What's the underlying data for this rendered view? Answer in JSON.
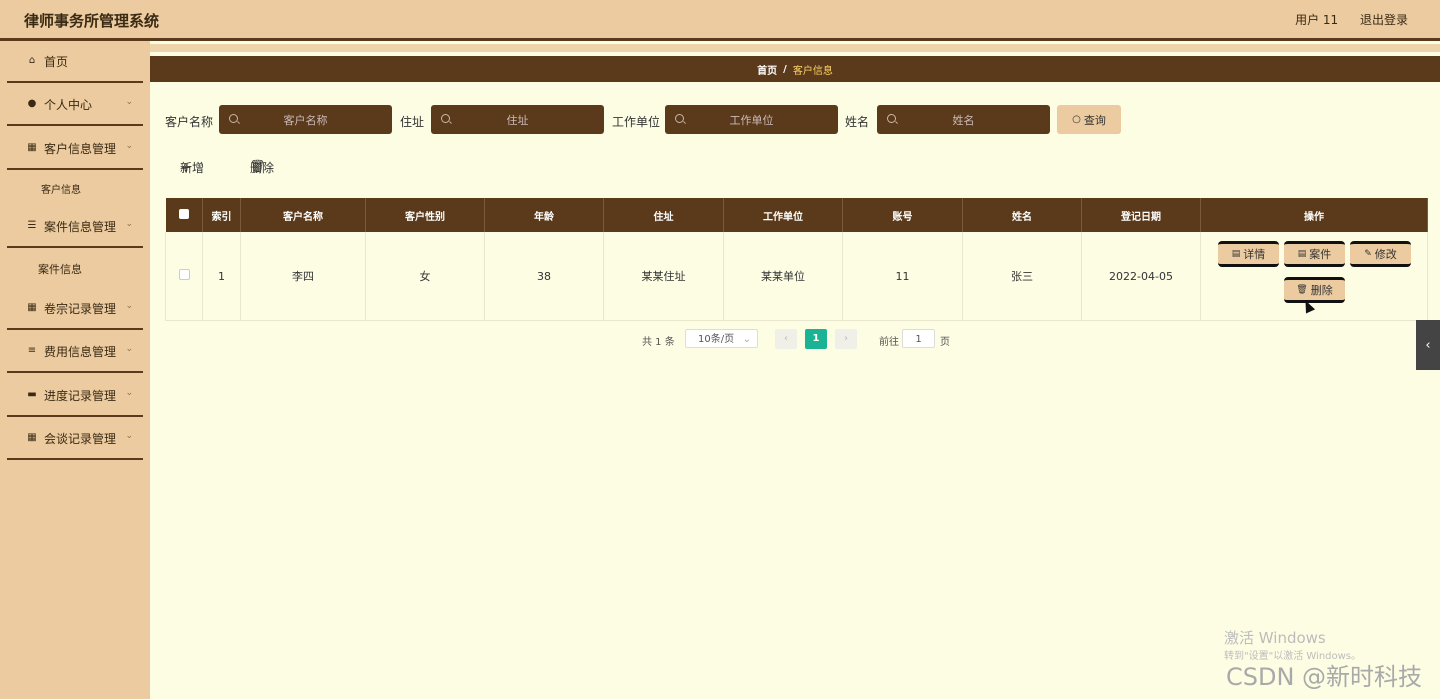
{
  "header": {
    "title": "律师事务所管理系统",
    "user": "用户 11",
    "logout": "退出登录"
  },
  "sidebar": {
    "items": [
      {
        "label": "首页",
        "icon": "home-icon"
      },
      {
        "label": "个人中心",
        "icon": "user-icon"
      },
      {
        "label": "客户信息管理",
        "icon": "grid-icon"
      },
      {
        "label": "客户信息",
        "icon": ""
      },
      {
        "label": "案件信息管理",
        "icon": "sliders-icon"
      },
      {
        "label": "案件信息",
        "icon": ""
      },
      {
        "label": "卷宗记录管理",
        "icon": "grid-icon"
      },
      {
        "label": "费用信息管理",
        "icon": "list-icon"
      },
      {
        "label": "进度记录管理",
        "icon": "monitor-icon"
      },
      {
        "label": "会谈记录管理",
        "icon": "grid-icon"
      }
    ]
  },
  "breadcrumb": {
    "home": "首页",
    "separator": "/",
    "current": "客户信息"
  },
  "search": {
    "fields": [
      {
        "label": "客户名称",
        "placeholder": "客户名称"
      },
      {
        "label": "住址",
        "placeholder": "住址"
      },
      {
        "label": "工作单位",
        "placeholder": "工作单位"
      },
      {
        "label": "姓名",
        "placeholder": "姓名"
      }
    ],
    "query_button": "查询"
  },
  "actions": {
    "add": "新增",
    "delete": "删除"
  },
  "table": {
    "columns": [
      "索引",
      "客户名称",
      "客户性别",
      "年龄",
      "住址",
      "工作单位",
      "账号",
      "姓名",
      "登记日期",
      "操作"
    ],
    "rows": [
      {
        "index": "1",
        "name": "李四",
        "gender": "女",
        "age": "38",
        "address": "某某住址",
        "company": "某某单位",
        "account": "11",
        "real_name": "张三",
        "date": "2022-04-05"
      }
    ],
    "row_actions": {
      "detail": "详情",
      "case": "案件",
      "edit": "修改",
      "delete": "删除"
    }
  },
  "pagination": {
    "total": "共 1 条",
    "page_size": "10条/页",
    "current": "1",
    "goto_label": "前往",
    "goto_value": "1",
    "goto_suffix": "页"
  },
  "watermark": {
    "line1": "激活 Windows",
    "line2": "转到\"设置\"以激活 Windows。",
    "line3": "CSDN @新时科技"
  },
  "colors": {
    "header_bg": "#ebcb9f",
    "dark_brown": "#5a3a1a",
    "content_bg": "#fdfde4",
    "pager_active": "#1ab394",
    "crumb_current": "#ffd36a"
  }
}
